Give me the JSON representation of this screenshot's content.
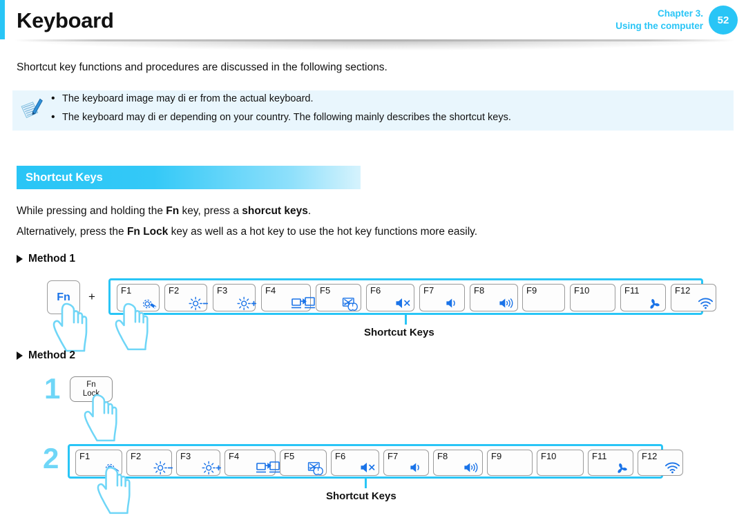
{
  "header": {
    "title": "Keyboard",
    "chapter_line1": "Chapter 3.",
    "chapter_line2": "Using the computer",
    "page_number": "52",
    "accent_color": "#29c5f6"
  },
  "intro": "Shortcut key functions and procedures are discussed in the following sections.",
  "note": {
    "icon": "note-pencil-icon",
    "bullet": "•",
    "items": [
      "The keyboard image may di  er from the actual keyboard.",
      "The keyboard may di  er depending on your country. The following mainly describes the shortcut keys."
    ]
  },
  "section": {
    "title": "Shortcut Keys"
  },
  "body": {
    "line1_a": "While pressing and holding the ",
    "line1_fn": "Fn",
    "line1_b": " key, press a ",
    "line1_shortcut": "shorcut keys",
    "line1_c": ".",
    "line2_a": "Alternatively, press the ",
    "line2_fnlock": "Fn Lock",
    "line2_b": " key as well as a hot key to use the hot key functions more easily."
  },
  "method1": {
    "heading": "Method 1",
    "fn_key": "Fn",
    "plus": "+",
    "callout": "Shortcut Keys"
  },
  "method2": {
    "heading": "Method 2",
    "step1_number": "1",
    "step2_number": "2",
    "fn_lock_line1": "Fn",
    "fn_lock_line2": "Lock",
    "callout": "Shortcut Keys"
  },
  "function_keys": [
    {
      "label": "F1",
      "icon": "settings-gear-wrench-icon"
    },
    {
      "label": "F2",
      "icon": "brightness-down-icon"
    },
    {
      "label": "F3",
      "icon": "brightness-up-icon"
    },
    {
      "label": "F4",
      "icon": "external-display-icon"
    },
    {
      "label": "F5",
      "icon": "touchpad-off-icon"
    },
    {
      "label": "F6",
      "icon": "volume-mute-icon"
    },
    {
      "label": "F7",
      "icon": "volume-down-icon"
    },
    {
      "label": "F8",
      "icon": "volume-up-icon"
    },
    {
      "label": "F9",
      "icon": "none"
    },
    {
      "label": "F10",
      "icon": "none"
    },
    {
      "label": "F11",
      "icon": "fan-silent-mode-icon"
    },
    {
      "label": "F12",
      "icon": "wireless-wifi-icon"
    }
  ]
}
